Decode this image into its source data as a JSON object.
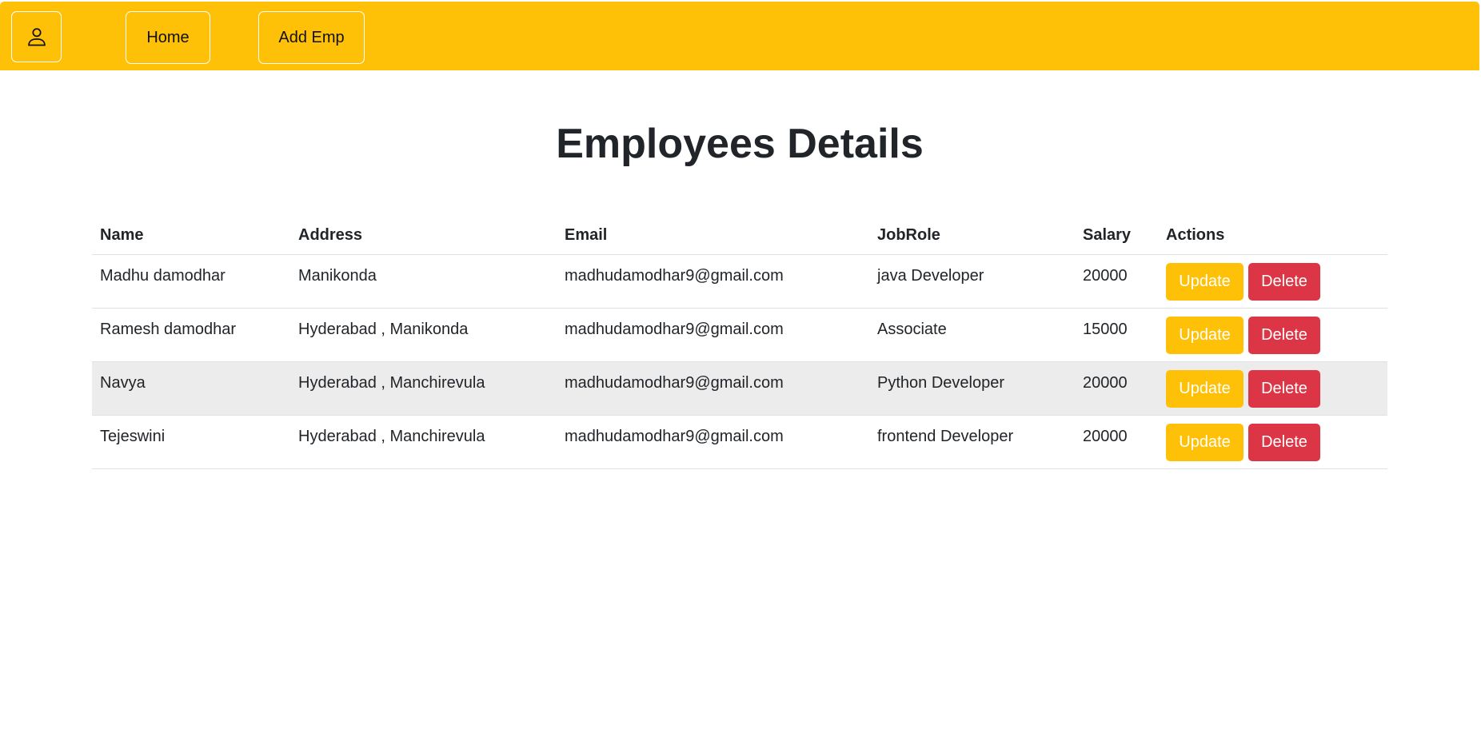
{
  "navbar": {
    "user_icon": "user-icon",
    "home_label": "Home",
    "add_label": "Add Emp",
    "color": "#ffc107"
  },
  "page": {
    "title": "Employees Details"
  },
  "table": {
    "headers": {
      "name": "Name",
      "address": "Address",
      "email": "Email",
      "jobrole": "JobRole",
      "salary": "Salary",
      "actions": "Actions"
    },
    "rows": [
      {
        "name": "Madhu damodhar",
        "address": "Manikonda",
        "email": "madhudamodhar9@gmail.com",
        "jobrole": "java Developer",
        "salary": "20000"
      },
      {
        "name": "Ramesh damodhar",
        "address": "Hyderabad , Manikonda",
        "email": "madhudamodhar9@gmail.com",
        "jobrole": "Associate",
        "salary": "15000"
      },
      {
        "name": "Navya",
        "address": "Hyderabad , Manchirevula",
        "email": "madhudamodhar9@gmail.com",
        "jobrole": "Python Developer",
        "salary": "20000"
      },
      {
        "name": "Tejeswini",
        "address": "Hyderabad , Manchirevula",
        "email": "madhudamodhar9@gmail.com",
        "jobrole": "frontend Developer",
        "salary": "20000"
      }
    ],
    "update_label": "Update",
    "delete_label": "Delete",
    "update_color": "#ffc107",
    "delete_color": "#dc3545",
    "highlight_row_color": "#ececec"
  }
}
